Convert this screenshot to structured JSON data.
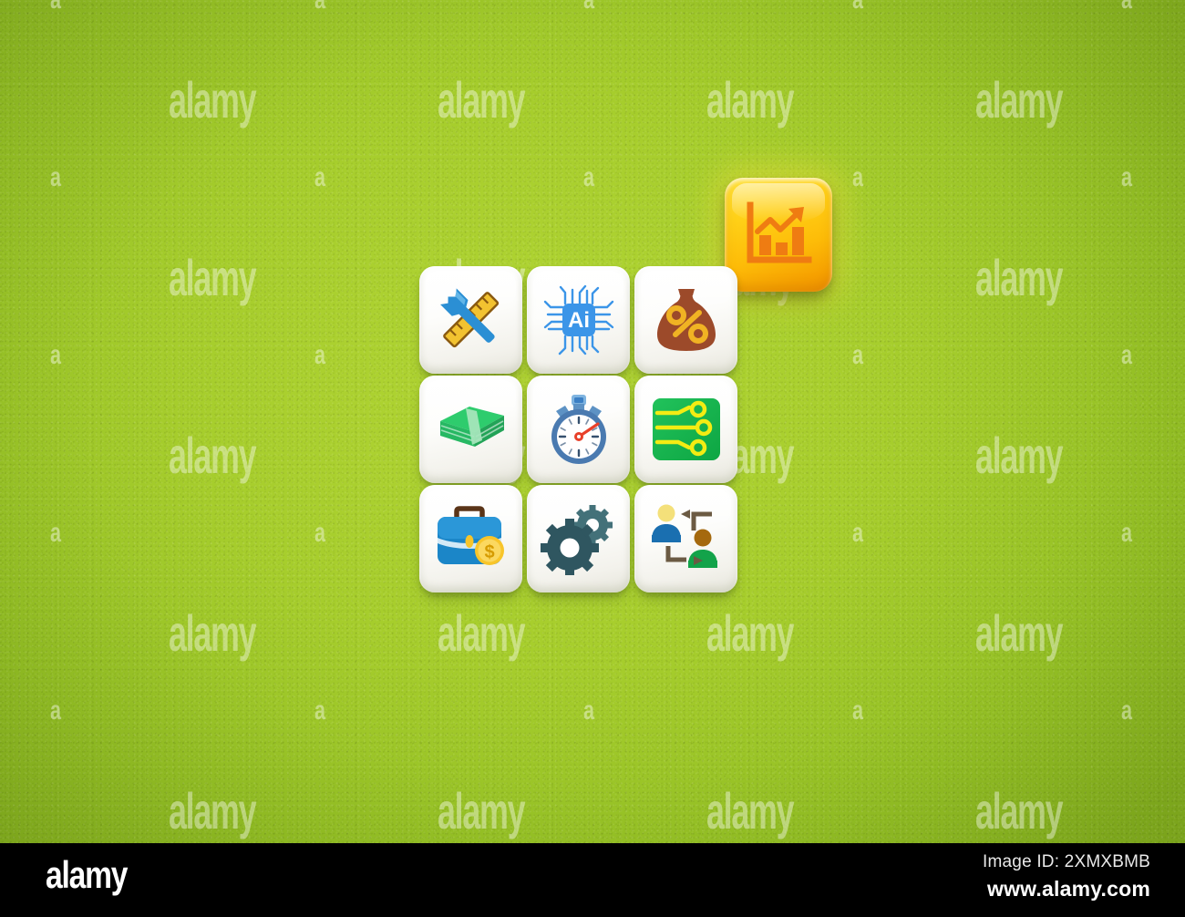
{
  "photo": {
    "background_color": "#a6cd2c",
    "description": "Nine white cubes in a 3x3 grid with business and technology icons, plus one highlighted yellow cube with a growth chart icon offset above the top-right corner, on a green paper background."
  },
  "watermark": {
    "letter": "a",
    "word": "alamy"
  },
  "grid": {
    "rows": 3,
    "columns": 3,
    "cubes": [
      {
        "position": "r1c1",
        "icon_name": "hammer-and-ruler-icon",
        "label": "Design and Build Tools",
        "colors": {
          "primary": "#2b8fd4",
          "secondary": "#f2c230"
        }
      },
      {
        "position": "r1c2",
        "icon_name": "ai-chip-icon",
        "label": "Artificial Intelligence Chip",
        "text": "Ai",
        "colors": {
          "primary": "#3b95e8",
          "secondary": "#ffffff"
        }
      },
      {
        "position": "r1c3",
        "icon_name": "money-bag-percent-icon",
        "label": "Money Bag with Percentage",
        "text": "%",
        "colors": {
          "primary": "#9c4a2a",
          "secondary": "#f0b323"
        }
      },
      {
        "position": "r2c1",
        "icon_name": "cash-stack-icon",
        "label": "Stack of Banknotes",
        "colors": {
          "primary": "#2ecc6d",
          "secondary": "#a8e6bd"
        }
      },
      {
        "position": "r2c2",
        "icon_name": "stopwatch-icon",
        "label": "Stopwatch Timer",
        "colors": {
          "primary": "#4a7ab0",
          "secondary": "#e8402a"
        }
      },
      {
        "position": "r2c3",
        "icon_name": "circuit-board-icon",
        "label": "Circuit Board Network",
        "colors": {
          "primary": "#12b24a",
          "secondary": "#f3ec13"
        }
      },
      {
        "position": "r3c1",
        "icon_name": "briefcase-dollar-icon",
        "label": "Business Briefcase with Dollar Coin",
        "text": "$",
        "colors": {
          "primary": "#1b86c8",
          "secondary": "#f8c52a"
        }
      },
      {
        "position": "r3c2",
        "icon_name": "gears-icon",
        "label": "Settings Gears",
        "colors": {
          "primary": "#2f5660",
          "secondary": "#437179"
        }
      },
      {
        "position": "r3c3",
        "icon_name": "people-workflow-icon",
        "label": "Team Collaboration Workflow",
        "colors": {
          "primary": "#1a6fb0",
          "secondary": "#13a34a"
        }
      }
    ]
  },
  "highlight_cube": {
    "icon_name": "growth-bar-chart-arrow-icon",
    "label": "Growth Bar Chart with Rising Arrow",
    "cube_color": "#ffd118",
    "icon_color": "#ef7c12"
  },
  "footer": {
    "logo": "alamy",
    "image_id": "Image ID: 2XMXBMB",
    "website": "www.alamy.com"
  }
}
